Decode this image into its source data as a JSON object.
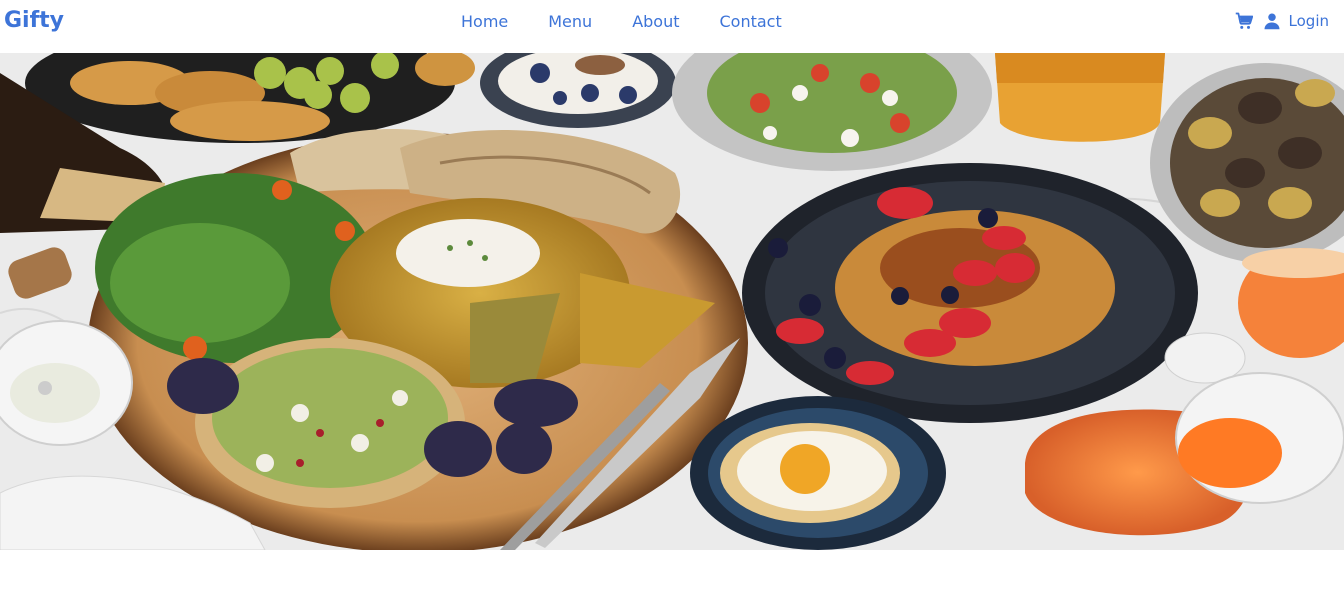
{
  "header": {
    "brand": "Gifty",
    "nav": [
      {
        "label": "Home"
      },
      {
        "label": "Menu"
      },
      {
        "label": "About"
      },
      {
        "label": "Contact"
      }
    ],
    "login_label": "Login",
    "cart_icon": "cart-icon",
    "user_icon": "user-icon"
  },
  "colors": {
    "accent": "#3d74d8",
    "background": "#ffffff"
  },
  "hero": {
    "image": "food spread photo with breads, salads, fruits, pancakes and drinks"
  }
}
